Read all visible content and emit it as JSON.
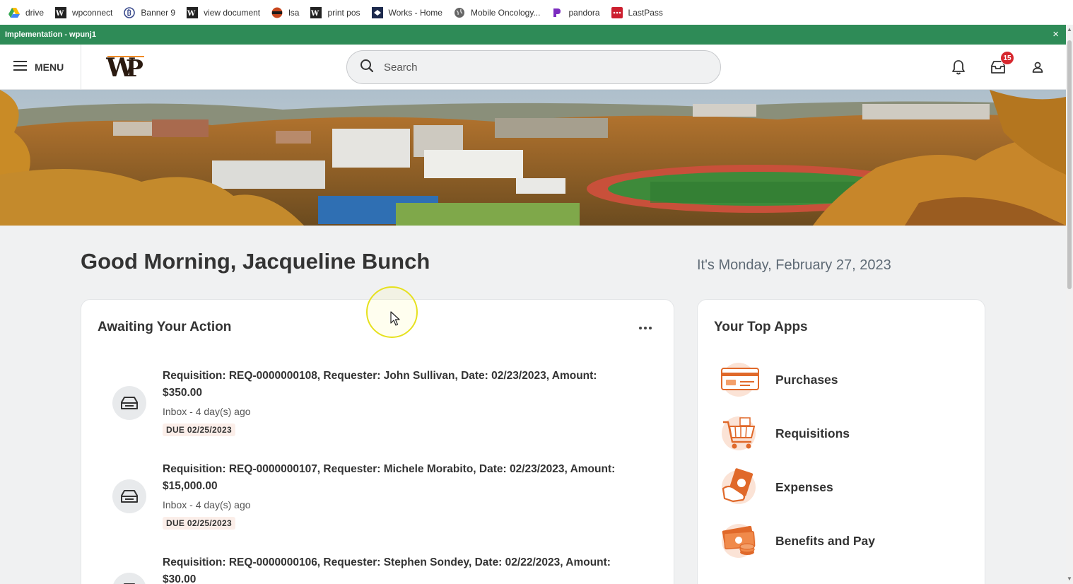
{
  "bookmarks": [
    {
      "label": "drive",
      "icon": "google-drive-icon"
    },
    {
      "label": "wpconnect",
      "icon": "wp-logo-icon"
    },
    {
      "label": "Banner 9",
      "icon": "banner-icon"
    },
    {
      "label": "view document",
      "icon": "wp-logo-icon"
    },
    {
      "label": "lsa",
      "icon": "lsa-icon"
    },
    {
      "label": "print pos",
      "icon": "wp-logo-icon"
    },
    {
      "label": "Works - Home",
      "icon": "works-icon"
    },
    {
      "label": "Mobile Oncology...",
      "icon": "globe-icon"
    },
    {
      "label": "pandora",
      "icon": "pandora-icon"
    },
    {
      "label": "LastPass",
      "icon": "lastpass-icon"
    }
  ],
  "env_bar": {
    "label": "Implementation - wpunj1",
    "close": "×"
  },
  "header": {
    "menu_label": "MENU",
    "search_placeholder": "Search",
    "inbox_badge": "15"
  },
  "greeting": "Good Morning, Jacqueline Bunch",
  "date": "It's Monday, February 27, 2023",
  "awaiting": {
    "title": "Awaiting Your Action",
    "tasks": [
      {
        "title_line1": "Requisition: REQ-0000000108, Requester: John Sullivan, Date: 02/23/2023, Amount:",
        "title_line2": "$350.00",
        "meta": "Inbox - 4 day(s) ago",
        "due": "DUE 02/25/2023"
      },
      {
        "title_line1": "Requisition: REQ-0000000107, Requester: Michele Morabito, Date: 02/23/2023, Amount:",
        "title_line2": "$15,000.00",
        "meta": "Inbox - 4 day(s) ago",
        "due": "DUE 02/25/2023"
      },
      {
        "title_line1": "Requisition: REQ-0000000106, Requester: Stephen Sondey, Date: 02/22/2023, Amount:",
        "title_line2": "$30.00",
        "meta": "",
        "due": ""
      }
    ]
  },
  "top_apps": {
    "title": "Your Top Apps",
    "apps": [
      {
        "label": "Purchases",
        "icon": "credit-card-icon"
      },
      {
        "label": "Requisitions",
        "icon": "shopping-cart-icon"
      },
      {
        "label": "Expenses",
        "icon": "expenses-hand-icon"
      },
      {
        "label": "Benefits and Pay",
        "icon": "money-coins-icon"
      }
    ]
  },
  "colors": {
    "env_bar": "#2e8b57",
    "badge": "#d7282f",
    "app_icon_orange": "#e0692a",
    "due_bg": "#fbeee9"
  }
}
